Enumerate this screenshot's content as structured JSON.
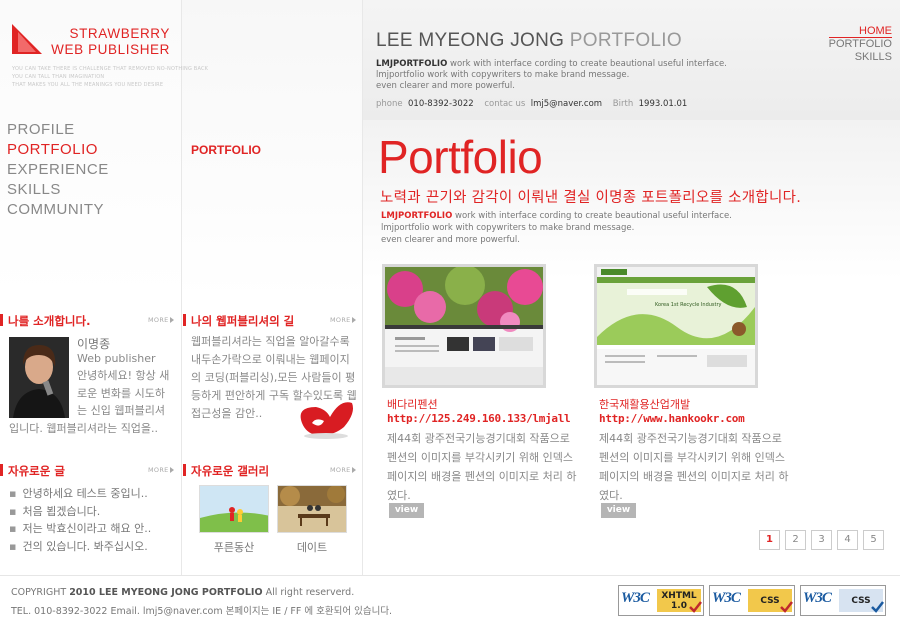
{
  "logo": {
    "line1": "STRAWBERRY",
    "line2": "WEB PUBLISHER",
    "tag1": "YOU CAN TAKE THERE IS CHALLENGE THAT REMOVED NO-NOTHING BACK",
    "tag2": "YOU CAN TALL THAN IMAGINATION",
    "tag3": "THAT MAKES YOU ALL THE MEANINGS YOU NEED DESIRE",
    "accent_color": "#e02424"
  },
  "left_nav": [
    "PROFILE",
    "PORTFOLIO",
    "EXPERIENCE",
    "SKILLS",
    "COMMUNITY"
  ],
  "left_nav_active": "PORTFOLIO",
  "mid_section_title": "PORTFOLIO",
  "header": {
    "title_main": "LEE MYEONG JONG",
    "title_accent": "PORTFOLIO",
    "intro_bold": "LMJPORTFOLIO",
    "intro_line1": " work with interface cording to create beautional useful interface.",
    "intro_line2": "lmjportfolio work with copywriters to make brand message.",
    "intro_line3": "even clearer and more powerful.",
    "contact": {
      "phone_label": "phone",
      "phone": "010-8392-3022",
      "contact_label": "contac us",
      "email": "lmj5@naver.com",
      "birth_label": "Birth",
      "birth": "1993.01.01"
    }
  },
  "top_nav": {
    "home": "HOME",
    "portfolio": "PORTFOLIO",
    "skills": "SKILLS"
  },
  "main": {
    "heading": "Portfolio",
    "subheading": "노력과 끈기와 감각이 이뤄낸 결실 이명종 포트폴리오를 소개합니다.",
    "intro_bold": "LMJPORTFOLIO",
    "intro_line1": " work with interface cording to create beautional useful interface.",
    "intro_line2": "lmjportfolio work with copywriters to make brand message.",
    "intro_line3": "even clearer and more powerful.",
    "works": [
      {
        "title": "배다리펜션",
        "url": "http://125.249.160.133/lmjall",
        "desc": "제44회 광주전국기능경기대회 작품으로 펜션의 이미지를 부각시키기 위해 인덱스 페이지의 배경을 펜션의 이미지로 처리 하였다.",
        "button": "view"
      },
      {
        "title": "한국재활용산업개발",
        "url": "http://www.hankookr.com",
        "desc": "제44회 광주전국기능경기대회 작품으로 펜션의 이미지를 부각시키기 위해 인덱스 페이지의 배경을 펜션의 이미지로 처리 하였다.",
        "button": "view",
        "thumb_text": "Korea 1st Recycle Industry"
      }
    ],
    "pages": [
      "1",
      "2",
      "3",
      "4",
      "5"
    ],
    "current_page": "1"
  },
  "intro_box": {
    "title": "나를 소개합니다.",
    "more": "MORE",
    "name": "이명종",
    "role": "Web publisher",
    "text_right": "안녕하세요! 항상 새로운 변화를 시도하는 신입 웹퍼블리셔",
    "text_bottom": "입니다. 웹퍼블리셔라는 직업을.."
  },
  "path_box": {
    "title": "나의 웹퍼블리셔의 길",
    "more": "MORE",
    "text": "웹퍼블리셔라는 직업을 알아갈수록 내두손가락으로 이뤄내는 웹페이지의 코딩(퍼블리싱),모든 사람들이 평등하게 편안하게 구독 할수있도록 웹접근성을 감안.."
  },
  "board_box": {
    "title": "자유로운 글",
    "more": "MORE",
    "items": [
      "안녕하세요 테스트 중입니..",
      "처음 뵙겠습니다.",
      "저는 박효신이라고 해요 안..",
      "건의 있습니다. 봐주십시오."
    ]
  },
  "gallery_box": {
    "title": "자유로운 갤러리",
    "more": "MORE",
    "items": [
      "푸른동산",
      "데이트"
    ]
  },
  "footer": {
    "copy_prefix": "COPYRIGHT",
    "copy_bold": "2010 LEE MYEONG JONG PORTFOLIO",
    "copy_suffix": "All right reserverd.",
    "line2": "TEL. 010-8392-3022 Email. lmj5@naver.com 본페이지는 IE / FF 에 호환되어 있습니다.",
    "badges": [
      {
        "label": "XHTML 1.0",
        "icon": "red-check-icon"
      },
      {
        "label": "CSS",
        "icon": "red-check-icon"
      },
      {
        "label": "CSS",
        "icon": "blue-check-icon"
      }
    ]
  }
}
